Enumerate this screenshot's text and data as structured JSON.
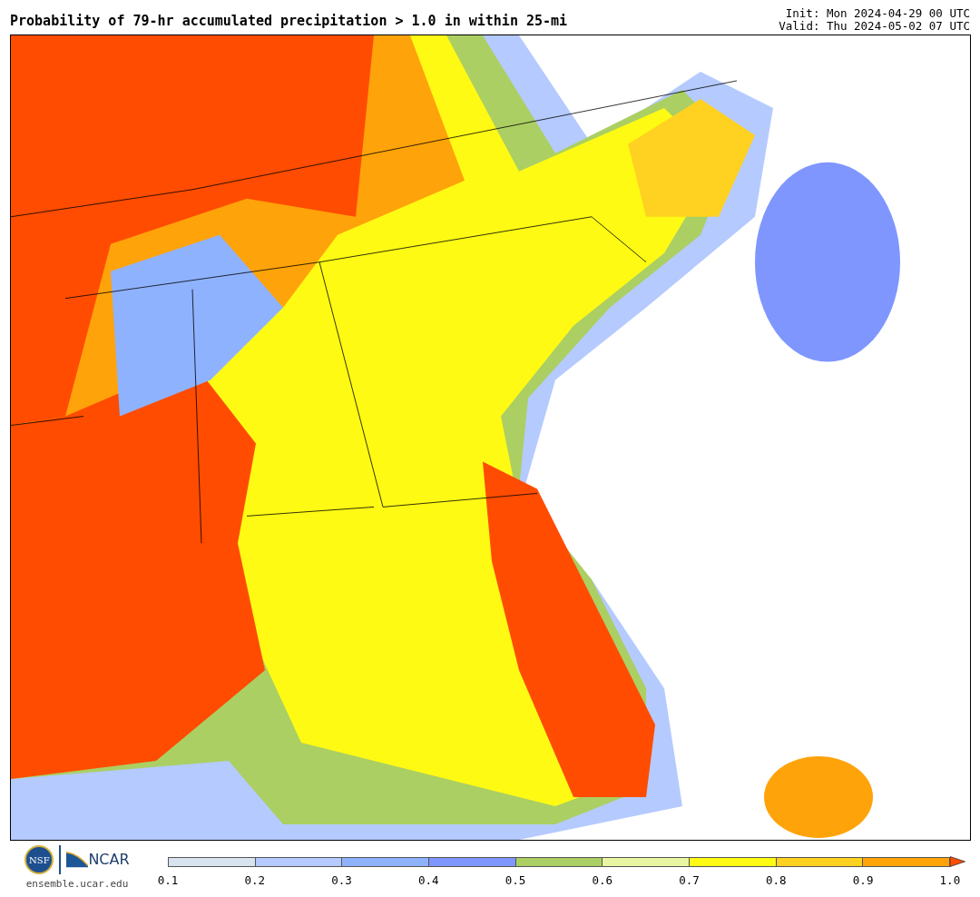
{
  "header": {
    "title": "Probability of 79-hr accumulated precipitation > 1.0 in within 25-mi",
    "init": "Init: Mon 2024-04-29 00 UTC",
    "valid": "Valid: Thu 2024-05-02 07 UTC"
  },
  "footer": {
    "nsf_logo_text": "NSF",
    "ncar_logo_text": "NCAR",
    "site": "ensemble.ucar.edu"
  },
  "legend": {
    "segments": [
      {
        "kind": "box",
        "color": "#d7e3ee"
      },
      {
        "kind": "box",
        "color": "#b5cafe"
      },
      {
        "kind": "box",
        "color": "#8fb2ff"
      },
      {
        "kind": "box",
        "color": "#7f96ff"
      },
      {
        "kind": "box",
        "color": "#abcf63"
      },
      {
        "kind": "box",
        "color": "#e8f5a3"
      },
      {
        "kind": "box",
        "color": "#fffa14"
      },
      {
        "kind": "box",
        "color": "#ffd121"
      },
      {
        "kind": "box",
        "color": "#ffa30a"
      },
      {
        "kind": "arrow",
        "color": "#ff4c00"
      }
    ],
    "ticks": [
      "0.1",
      "0.2",
      "0.3",
      "0.4",
      "0.5",
      "0.6",
      "0.7",
      "0.8",
      "0.9",
      "1.0"
    ]
  }
}
